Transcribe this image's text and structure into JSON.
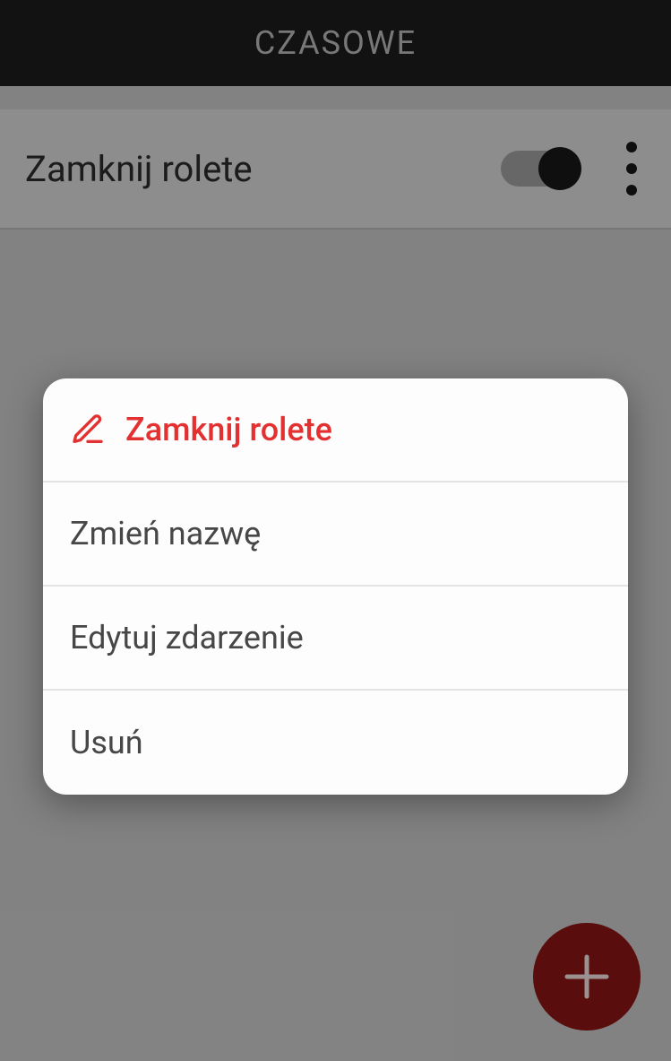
{
  "header": {
    "title": "CZASOWE"
  },
  "event": {
    "name": "Zamknij rolete",
    "enabled": true
  },
  "dialog": {
    "title": "Zamknij rolete",
    "options": {
      "rename": "Zmień nazwę",
      "edit": "Edytuj zdarzenie",
      "delete": "Usuń"
    }
  },
  "colors": {
    "accent": "#e33131",
    "fab": "#7d1313"
  }
}
